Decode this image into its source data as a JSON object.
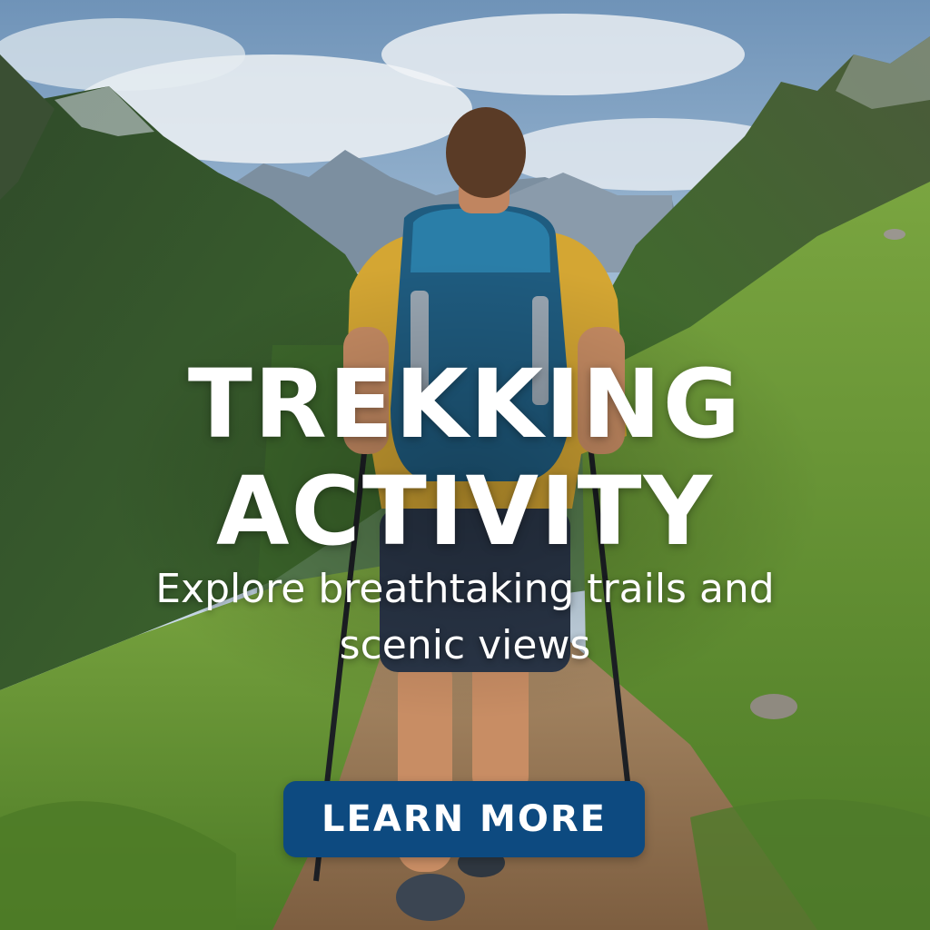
{
  "hero": {
    "headline_line1": "TREKKING",
    "headline_line2": "ACTIVITY",
    "subtitle": "Explore breathtaking trails and scenic views"
  },
  "cta": {
    "label": "LEARN MORE"
  },
  "colors": {
    "cta_background": "#0d4a80",
    "text": "#ffffff",
    "sky": "#a9c6e0",
    "grass": "#5f8f34",
    "trail": "#9b7a58"
  },
  "background": {
    "icon": "hiker-mountain-landscape"
  }
}
